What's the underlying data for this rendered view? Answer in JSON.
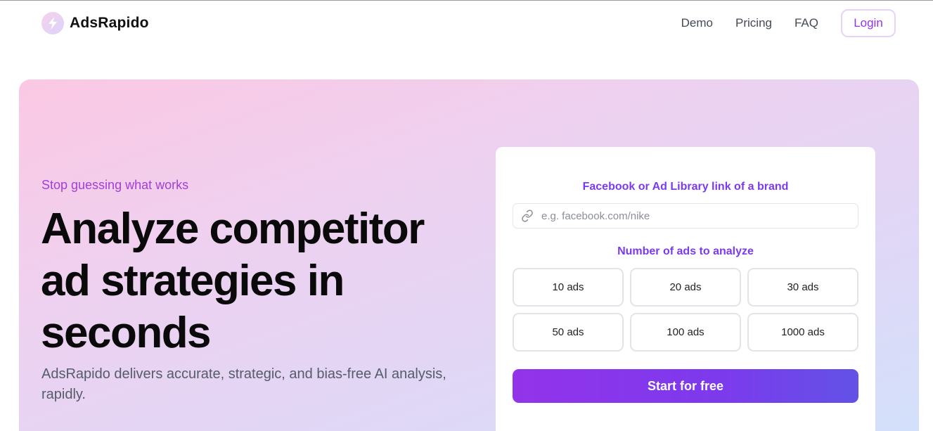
{
  "nav": {
    "brand": "AdsRapido",
    "logo_icon": "lightning-bolt-icon",
    "links": [
      "Demo",
      "Pricing",
      "FAQ"
    ],
    "login_label": "Login"
  },
  "hero": {
    "eyebrow": "Stop guessing what works",
    "headline": "Analyze competitor ad strategies in seconds",
    "subtext": "AdsRapido delivers accurate, strategic, and bias-free AI analysis, rapidly."
  },
  "form": {
    "link_label": "Facebook or Ad Library link of a brand",
    "link_placeholder": "e.g. facebook.com/nike",
    "link_icon": "link-icon",
    "count_label": "Number of ads to analyze",
    "options": [
      "10 ads",
      "20 ads",
      "30 ads",
      "50 ads",
      "100 ads",
      "1000 ads"
    ],
    "submit_label": "Start for free"
  },
  "colors": {
    "accent": "#9333ea",
    "label_purple": "#7c3aed",
    "button_gradient_end": "#6252e6",
    "hero_pink": "#fbc8e3",
    "hero_blue": "#d3e0fb"
  }
}
